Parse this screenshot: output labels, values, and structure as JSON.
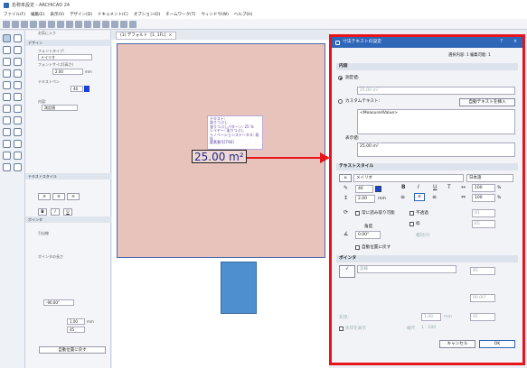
{
  "window": {
    "title": "名称未設定 - ARCHICAD 24"
  },
  "menu": [
    "ファイル(F)",
    "編集(E)",
    "表示(V)",
    "デザイン(D)",
    "ドキュメント(C)",
    "オプション(O)",
    "チームワーク(T)",
    "ウィンドウ(W)",
    "ヘルプ(H)"
  ],
  "tab": {
    "label": "[1. 1FL]",
    "view": "(1) デフォルト"
  },
  "infobox": {
    "sections": {
      "design": "デザイン",
      "favorite": "お気に入り",
      "text_style": "テキストスタイル",
      "pointer": "ポインタ",
      "pointer2": "ポインタの長さ"
    },
    "labels": {
      "font_type": "フォントタイプ:",
      "font_size": "フォントサイズ(高さ)",
      "text_pen": "テキストペン",
      "content": "内容:",
      "auto_position": "自動位置に戻す",
      "leader": "引出線",
      "decimals": "小数点以下の桁数"
    },
    "font": "メイリオ",
    "font_size": "2.00",
    "font_size_unit": "mm",
    "text_pen": "46",
    "content_value": "測定値",
    "pointer_len": "1.00",
    "pointer_len_unit": "mm",
    "pointer_count": "45",
    "angle": "-90.00°",
    "reset_button": "自動位置に戻す"
  },
  "canvas": {
    "tooltip": [
      "テキスト:",
      "塗りつぶし",
      "塗りつぶしパターン: 25 %",
      "レイヤー: 塗りつぶし",
      "リノベーションステータス: 既存",
      "要素番号[TAB]"
    ],
    "measurement": "25.00 m²"
  },
  "dialog": {
    "title": "寸法テキストの設定",
    "selected_info": "選択内容: 1 編集可能: 1",
    "content_section": "内容",
    "measured_label": "測定値:",
    "measured_value": "25.00 m²",
    "custom_label": "カスタムテキスト:",
    "autotext_button": "自動テキストを挿入",
    "custom_value": "<MeasuredValue>",
    "display_label": "表示値:",
    "display_value": "25.00 m²",
    "style_section": "テキストスタイル",
    "font": "メイリオ",
    "font_script": "日本語",
    "pen": "46",
    "size": "2.00",
    "size_unit": "mm",
    "width_pct": "100",
    "spacing_pct": "100",
    "fit_label": "常に読み取り可能",
    "opaque_label": "不透過",
    "frame_label": "枠",
    "pen2": "91",
    "pen3": "65",
    "angle_label": "角度",
    "angle_value": "0.00°",
    "relative_label": "相対(Y)",
    "reset_label": "自動位置に戻す",
    "pointer_section": "ポインタ",
    "line_type": "実線",
    "pen4": "95",
    "pointer_angle": "90.00°",
    "tail_label": "矢印:",
    "tail_size": "1.00",
    "tail_unit": "mm",
    "tail_pen": "45",
    "scale_label": "縮尺",
    "scale_value": "1 : 100",
    "show_label": "矢印を表示",
    "cancel": "キャンセル",
    "ok": "OK"
  },
  "colors": {
    "accent": "#2e66b8",
    "highlight_frame": "#e8141c",
    "room_fill": "#e8c3bb",
    "blue_element": "#4e8fd0",
    "text_color": "#1a40d6"
  }
}
